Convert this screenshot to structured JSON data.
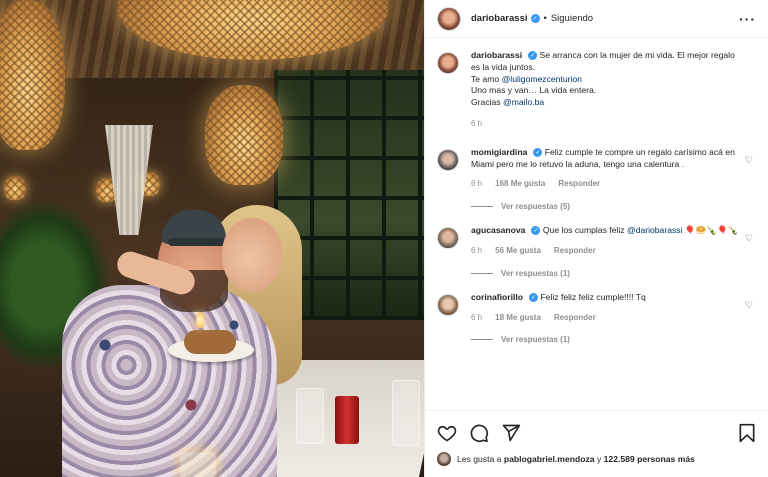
{
  "post": {
    "author": "dariobarassi",
    "separator": "•",
    "follow_state": "Siguiendo",
    "more_icon": "more-options-icon"
  },
  "caption": {
    "username": "dariobarassi",
    "line1": "Se arranca con la mujer de mi vida. El mejor regalo es la vida juntos.",
    "line2_prefix": "Te amo",
    "line2_mention": "@luligomezcenturion",
    "line3": "Uno mas y van… La vida entera.",
    "line4_prefix": "Gracias",
    "line4_mention": "@mailo.ba",
    "time": "6 h"
  },
  "comments": [
    {
      "username": "momigiardina",
      "text": "Feliz cumple te compre un regalo carísimo acá en Miami pero me lo retuvo la aduna, tengo una calentura .",
      "time": "6 h",
      "likes": "168 Me gusta",
      "reply": "Responder",
      "view_replies": "Ver respuestas (5)"
    },
    {
      "username": "agucasanova",
      "text_prefix": "Que los cumplas feliz",
      "mention": "@dariobarassi",
      "emojis": "🎈🥯🍾🎈🍾",
      "time": "6 h",
      "likes": "56 Me gusta",
      "reply": "Responder",
      "view_replies": "Ver respuestas (1)"
    },
    {
      "username": "corinafiorillo",
      "text": "Feliz feliz feliz cumple!!!! Tq",
      "time": "6 h",
      "likes": "18 Me gusta",
      "reply": "Responder",
      "view_replies": "Ver respuestas (1)"
    }
  ],
  "likes_line": {
    "prefix": "Les gusta a",
    "user": "pablogabriel.mendoza",
    "middle": "y",
    "count": "122.589 personas más"
  },
  "colors": {
    "verified": "#3897f0",
    "mention": "#00376b",
    "muted": "#8e8e8e",
    "text": "#262626"
  }
}
